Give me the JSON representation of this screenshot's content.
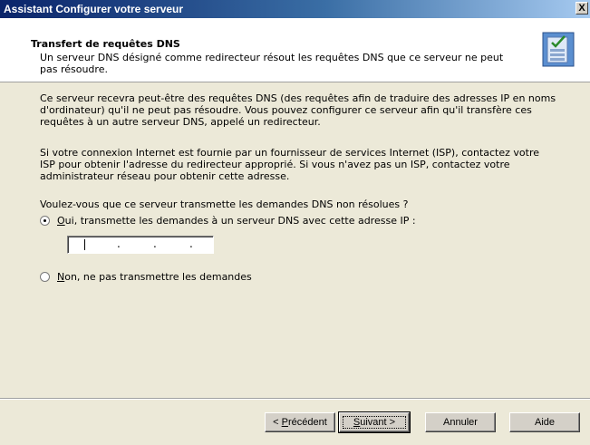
{
  "window": {
    "title": "Assistant Configurer votre serveur",
    "close_label": "X"
  },
  "header": {
    "title": "Transfert de requêtes DNS",
    "description": "Un serveur DNS désigné comme redirecteur résout les requêtes DNS que ce serveur ne peut pas résoudre."
  },
  "content": {
    "paragraph1": "Ce serveur recevra peut-être des requêtes DNS (des requêtes afin de traduire des adresses IP en noms d'ordinateur) qu'il ne peut pas résoudre. Vous pouvez configurer ce serveur afin qu'il transfère ces requêtes à un autre serveur DNS, appelé un redirecteur.",
    "paragraph2": "Si votre connexion Internet est fournie par un fournisseur de services Internet (ISP), contactez votre ISP pour obtenir l'adresse du redirecteur approprié. Si vous n'avez pas un ISP, contactez votre administrateur réseau pour obtenir cette adresse.",
    "question": "Voulez-vous que ce serveur transmette les demandes DNS non résolues ?",
    "option_yes": {
      "accel": "O",
      "label_rest": "ui, transmette les demandes à un serveur DNS avec cette adresse IP :",
      "checked": true
    },
    "option_no": {
      "accel": "N",
      "label_rest": "on, ne pas transmettre les demandes",
      "checked": false
    },
    "ip_value": ""
  },
  "buttons": {
    "back_prefix": "< ",
    "back_accel": "P",
    "back_rest": "récédent",
    "next_accel": "S",
    "next_rest": "uivant >",
    "cancel": "Annuler",
    "help": "Aide"
  }
}
